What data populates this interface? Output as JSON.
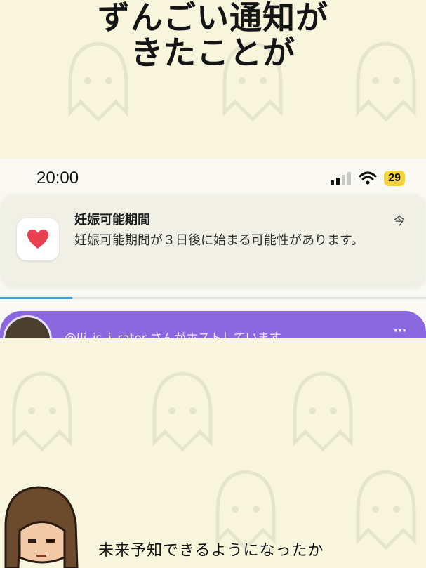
{
  "headline": {
    "line1": "ずんごい通知が",
    "line2": "きたことが"
  },
  "phone": {
    "status_time": "20:00",
    "battery_level": "29",
    "notification": {
      "app_icon": "heart-icon",
      "title": "妊娠可能期間",
      "body": "妊娠可能期間が３日後に始まる可能性があります。",
      "time": "今"
    },
    "progress_fraction": 0.17,
    "host_bar": {
      "text": "@Ili_is_i_rator さんがホストしています",
      "menu_icon": "more-icon"
    }
  },
  "caption": "未来予知できるようになったか",
  "colors": {
    "background": "#f7f6dc",
    "host_bar": "#8b68e0",
    "heart": "#e84050",
    "battery": "#f3d23c",
    "progress": "#3ba0d8"
  }
}
